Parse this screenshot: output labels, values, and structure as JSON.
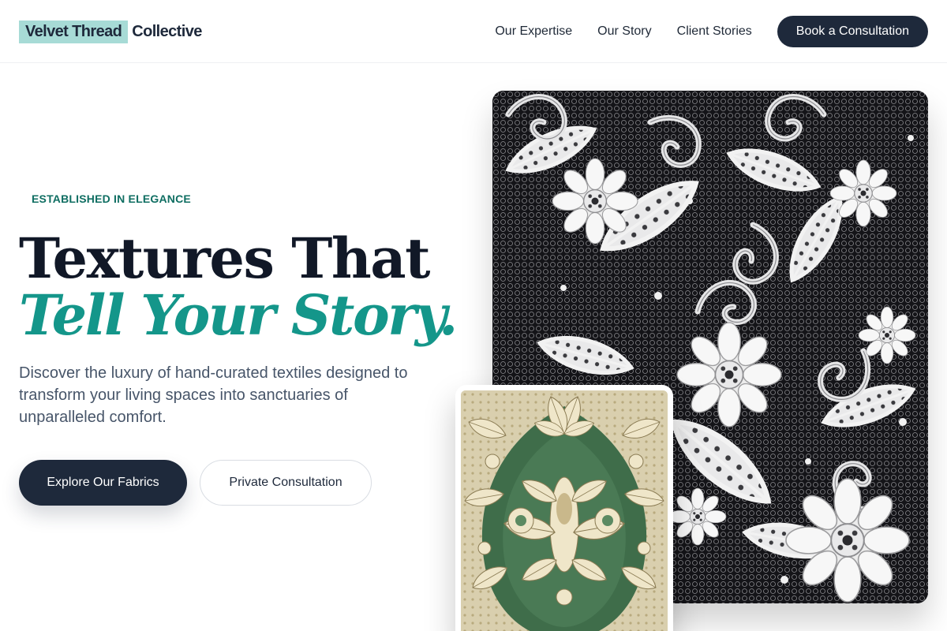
{
  "brand": {
    "highlight": "Velvet Thread",
    "rest": "Collective"
  },
  "nav": {
    "links": [
      "Our Expertise",
      "Our Story",
      "Client Stories"
    ],
    "cta": "Book a Consultation"
  },
  "hero": {
    "eyebrow": "ESTABLISHED IN ELEGANCE",
    "headline_line1": "Textures That",
    "headline_line2": "Tell Your Story.",
    "lead": "Discover the luxury of hand-curated textiles designed to transform your living spaces into sanctuaries of unparalleled comfort.",
    "primary_button": "Explore Our Fabrics",
    "secondary_button": "Private Consultation"
  },
  "colors": {
    "navy": "#1e293b",
    "teal": "#14968a",
    "eyebrow_green": "#0f6e62",
    "logo_highlight": "#a7dbd6"
  }
}
